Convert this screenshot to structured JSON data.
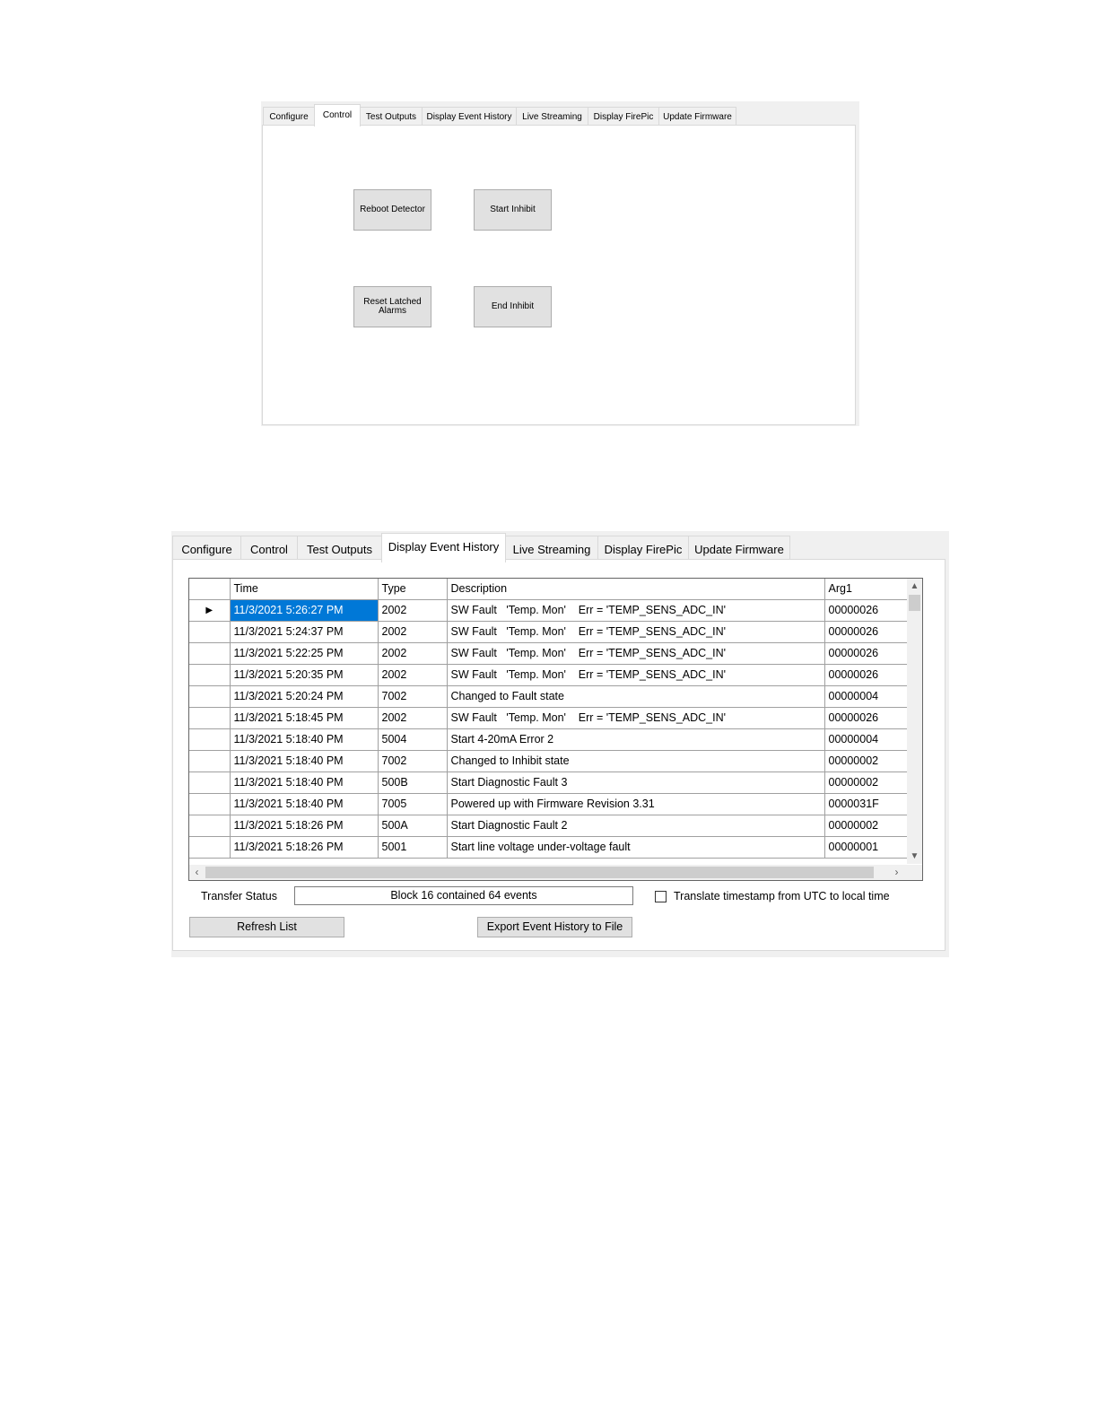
{
  "control_window": {
    "tabs": [
      {
        "label": "Configure"
      },
      {
        "label": "Control"
      },
      {
        "label": "Test Outputs"
      },
      {
        "label": "Display Event History"
      },
      {
        "label": "Live Streaming"
      },
      {
        "label": "Display FirePic"
      },
      {
        "label": "Update Firmware"
      }
    ],
    "active_tab": "Control",
    "buttons": {
      "reboot_detector": "Reboot Detector",
      "start_inhibit": "Start Inhibit",
      "reset_latched_line1": "Reset Latched",
      "reset_latched_line2": "Alarms",
      "end_inhibit": "End Inhibit"
    }
  },
  "history_window": {
    "tabs": [
      {
        "label": "Configure"
      },
      {
        "label": "Control"
      },
      {
        "label": "Test Outputs"
      },
      {
        "label": "Display Event History"
      },
      {
        "label": "Live Streaming"
      },
      {
        "label": "Display FirePic"
      },
      {
        "label": "Update Firmware"
      }
    ],
    "active_tab": "Display Event History",
    "grid": {
      "columns": {
        "time": "Time",
        "type": "Type",
        "description": "Description",
        "arg1": "Arg1"
      },
      "current_row_marker": "▶",
      "rows": [
        {
          "time": "11/3/2021 5:26:27 PM",
          "type": "2002",
          "description": "SW Fault   'Temp. Mon'    Err = 'TEMP_SENS_ADC_IN'",
          "arg1": "00000026"
        },
        {
          "time": "11/3/2021 5:24:37 PM",
          "type": "2002",
          "description": "SW Fault   'Temp. Mon'    Err = 'TEMP_SENS_ADC_IN'",
          "arg1": "00000026"
        },
        {
          "time": "11/3/2021 5:22:25 PM",
          "type": "2002",
          "description": "SW Fault   'Temp. Mon'    Err = 'TEMP_SENS_ADC_IN'",
          "arg1": "00000026"
        },
        {
          "time": "11/3/2021 5:20:35 PM",
          "type": "2002",
          "description": "SW Fault   'Temp. Mon'    Err = 'TEMP_SENS_ADC_IN'",
          "arg1": "00000026"
        },
        {
          "time": "11/3/2021 5:20:24 PM",
          "type": "7002",
          "description": "Changed to Fault state",
          "arg1": "00000004"
        },
        {
          "time": "11/3/2021 5:18:45 PM",
          "type": "2002",
          "description": "SW Fault   'Temp. Mon'    Err = 'TEMP_SENS_ADC_IN'",
          "arg1": "00000026"
        },
        {
          "time": "11/3/2021 5:18:40 PM",
          "type": "5004",
          "description": "Start 4-20mA Error 2",
          "arg1": "00000004"
        },
        {
          "time": "11/3/2021 5:18:40 PM",
          "type": "7002",
          "description": "Changed to Inhibit state",
          "arg1": "00000002"
        },
        {
          "time": "11/3/2021 5:18:40 PM",
          "type": "500B",
          "description": "Start Diagnostic Fault 3",
          "arg1": "00000002"
        },
        {
          "time": "11/3/2021 5:18:40 PM",
          "type": "7005",
          "description": "Powered up with Firmware Revision 3.31",
          "arg1": "0000031F"
        },
        {
          "time": "11/3/2021 5:18:26 PM",
          "type": "500A",
          "description": "Start Diagnostic Fault 2",
          "arg1": "00000002"
        },
        {
          "time": "11/3/2021 5:18:26 PM",
          "type": "5001",
          "description": "Start line voltage under-voltage fault",
          "arg1": "00000001"
        }
      ]
    },
    "transfer_status_label": "Transfer Status",
    "transfer_status_value": "Block 16 contained 64 events",
    "translate_checkbox_label": "Translate timestamp from UTC to local time",
    "translate_checked": false,
    "refresh_button": "Refresh List",
    "export_button": "Export Event History to File"
  },
  "colors": {
    "selection": "#0078d7",
    "button_face": "#e1e1e1",
    "window_bg": "#f0f0f0"
  }
}
